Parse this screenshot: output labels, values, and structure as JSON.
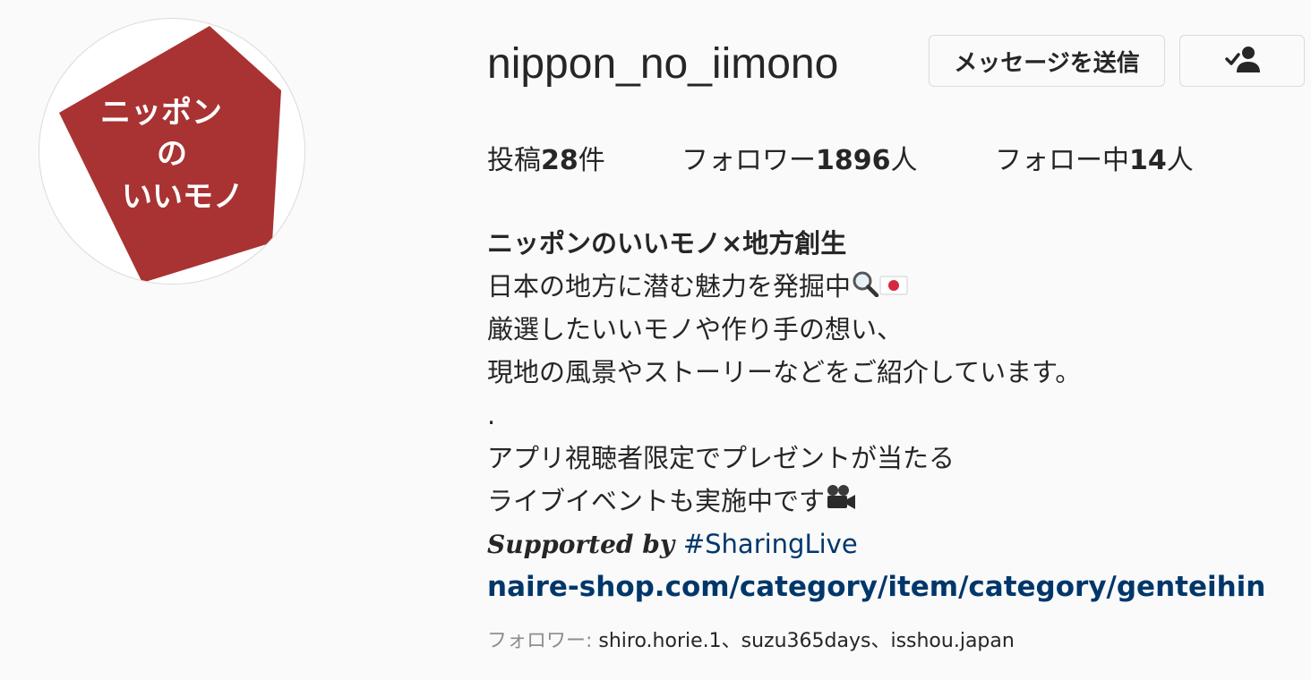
{
  "profile": {
    "username": "nippon_no_iimono",
    "avatar_text": [
      "ニッポン",
      "の",
      "いいモノ"
    ],
    "avatar_color": "#a93332",
    "message_button_label": "メッセージを送信",
    "follow_button_icon": "person-check-icon"
  },
  "stats": [
    {
      "label": "投稿",
      "value": "28",
      "unit": "件"
    },
    {
      "label": "フォロワー",
      "value": "1896",
      "unit": "人"
    },
    {
      "label": "フォロー中",
      "value": "14",
      "unit": "人"
    }
  ],
  "bio": {
    "title": "ニッポンのいいモノ×地方創生",
    "line1": "日本の地方に潜む魅力を発掘中",
    "line1_icons": [
      "magnifying-glass-icon",
      "japan-flag-icon"
    ],
    "line2": "厳選したいいモノや作り手の想い、",
    "line3": "現地の風景やストーリーなどをご紹介しています。",
    "line4": ".",
    "line5": "アプリ視聴者限定でプレゼントが当たる",
    "line6": "ライブイベントも実施中です",
    "line6_icon": "video-camera-icon",
    "supported_text": "Supported by ",
    "hashtag": "#SharingLive",
    "link": "naire-shop.com/category/item/category/genteihin"
  },
  "followed_by": {
    "label": "フォロワー: ",
    "names": "shiro.horie.1、suzu365days、isshou.japan"
  },
  "colors": {
    "link": "#00376b",
    "text": "#262626",
    "muted": "#8e8e8e",
    "background": "#fafafa"
  }
}
